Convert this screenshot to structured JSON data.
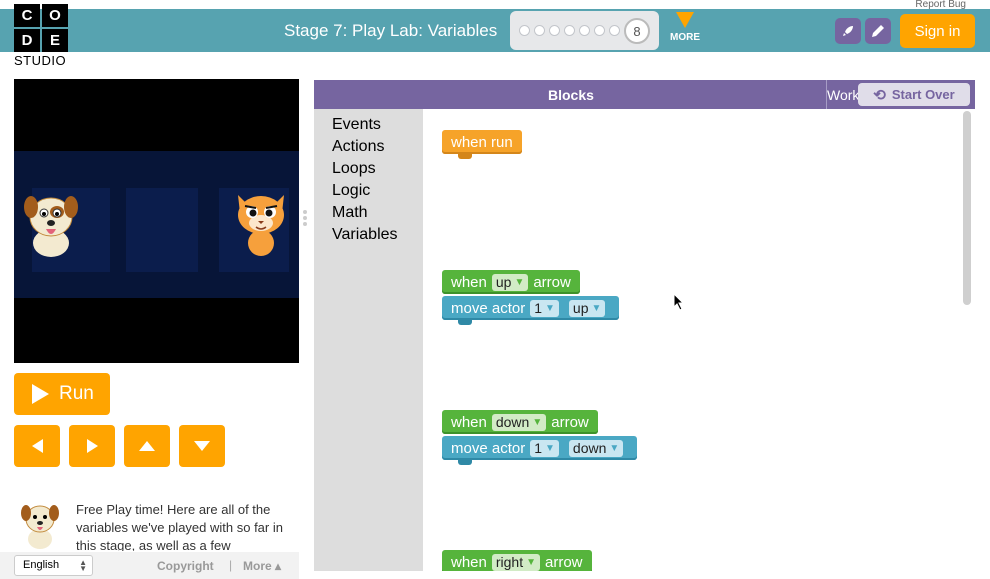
{
  "header": {
    "report_bug": "Report Bug",
    "logo_letters": [
      "C",
      "O",
      "D",
      "E"
    ],
    "logo_studio": "STUDIO",
    "stage_title": "Stage 7: Play Lab: Variables",
    "progress_dots": 7,
    "current_level": "8",
    "more_label": "MORE",
    "rocket_icon": "rocket-icon",
    "pencil_icon": "pencil-icon",
    "sign_in": "Sign in",
    "colors": {
      "bar": "#57a3b0",
      "accent": "#ffa400",
      "purple": "#7665a0"
    }
  },
  "controls": {
    "run_label": "Run",
    "arrows": [
      "left",
      "right",
      "up",
      "down"
    ]
  },
  "instructions": {
    "text": "Free Play time! Here are all of the variables we've played with so far in this stage, as well as a few"
  },
  "footer": {
    "language": "English",
    "copyright": "Copyright",
    "separator": "|",
    "more": "More ▴"
  },
  "workspace": {
    "blocks_label": "Blocks",
    "workspace_label": "Workspace",
    "start_over": "Start Over",
    "categories": [
      "Events",
      "Actions",
      "Loops",
      "Logic",
      "Math",
      "Variables"
    ]
  },
  "blocks": {
    "when_run": "when run",
    "when": "when",
    "arrow": "arrow",
    "move_actor": "move actor",
    "up": "up",
    "down": "down",
    "right": "right",
    "actor_num": "1",
    "dd_caret": "▼"
  }
}
